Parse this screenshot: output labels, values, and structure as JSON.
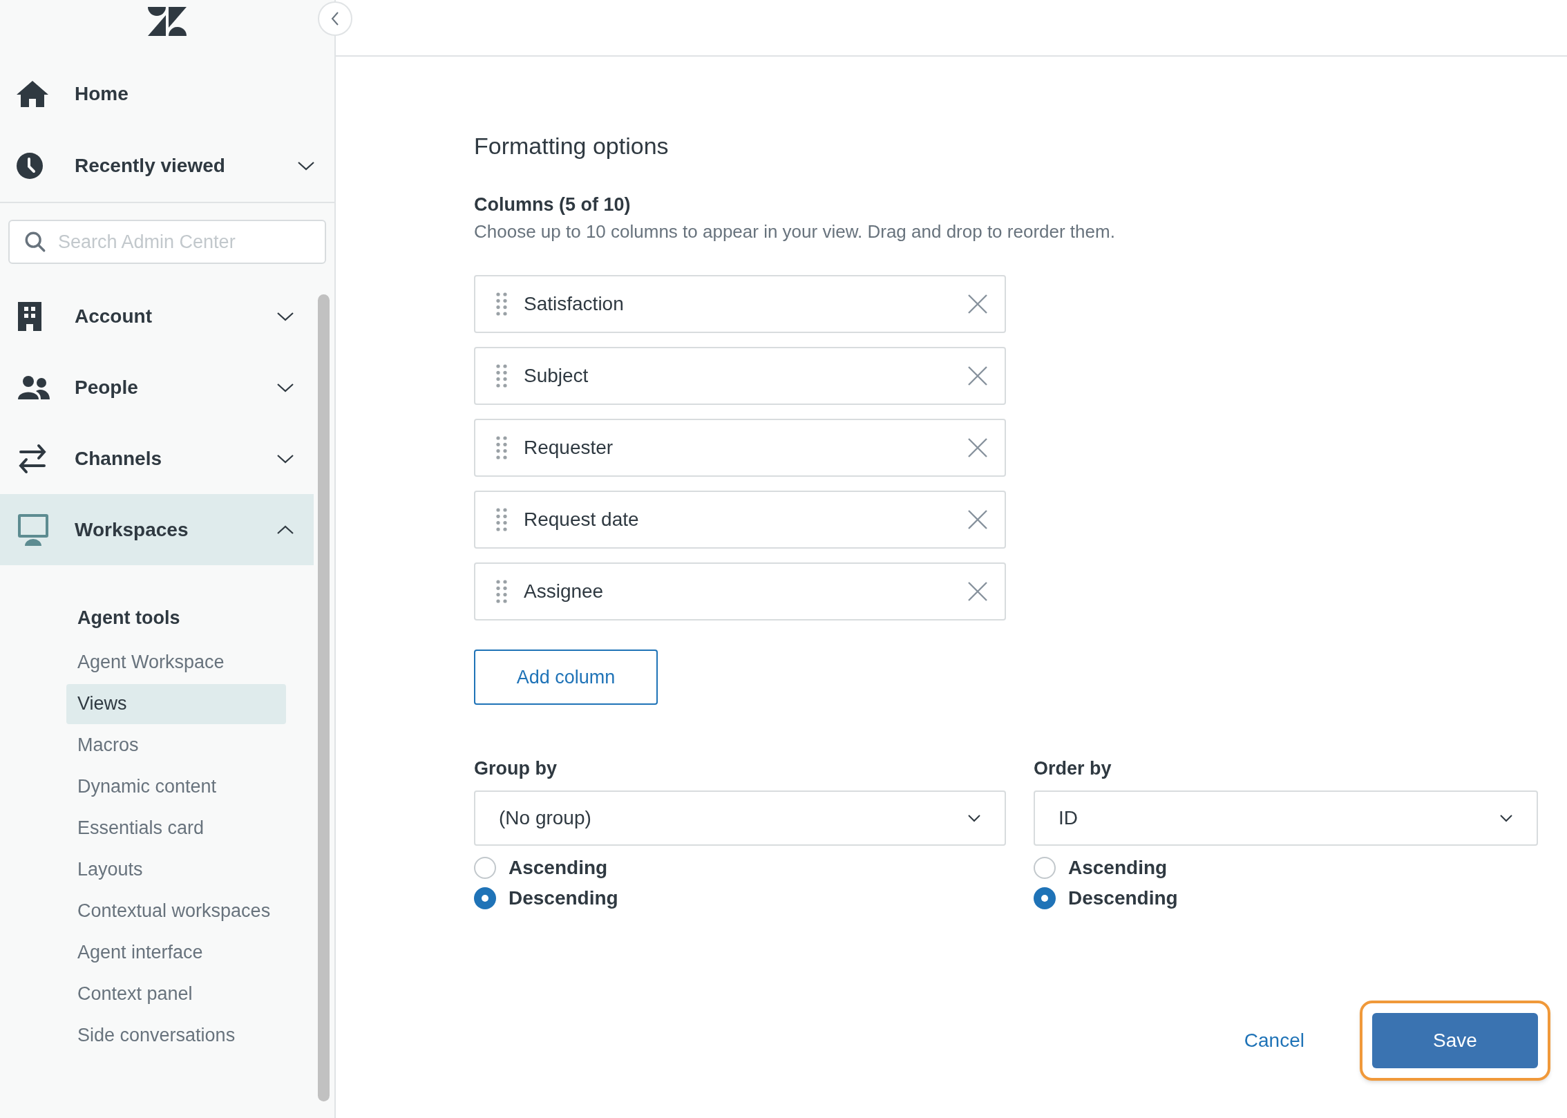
{
  "sidebar": {
    "top_items": [
      {
        "label": "Home",
        "kind": "link"
      },
      {
        "label": "Recently viewed",
        "kind": "menu",
        "expanded": false
      }
    ],
    "search": {
      "placeholder": "Search Admin Center"
    },
    "nav_items": [
      {
        "label": "Account",
        "expanded": false,
        "selected": false
      },
      {
        "label": "People",
        "expanded": false,
        "selected": false
      },
      {
        "label": "Channels",
        "expanded": false,
        "selected": false
      },
      {
        "label": "Workspaces",
        "expanded": true,
        "selected": true,
        "section": {
          "heading": "Agent tools",
          "items": [
            {
              "label": "Agent Workspace",
              "selected": false
            },
            {
              "label": "Views",
              "selected": true
            },
            {
              "label": "Macros",
              "selected": false
            },
            {
              "label": "Dynamic content",
              "selected": false
            },
            {
              "label": "Essentials card",
              "selected": false
            },
            {
              "label": "Layouts",
              "selected": false
            },
            {
              "label": "Contextual workspaces",
              "selected": false
            },
            {
              "label": "Agent interface",
              "selected": false
            },
            {
              "label": "Context panel",
              "selected": false
            },
            {
              "label": "Side conversations",
              "selected": false
            }
          ]
        }
      }
    ]
  },
  "main": {
    "heading": "Formatting options",
    "columns": {
      "title": "Columns (5 of 10)",
      "description": "Choose up to 10 columns to appear in your view. Drag and drop to reorder them.",
      "items": [
        "Satisfaction",
        "Subject",
        "Requester",
        "Request date",
        "Assignee"
      ],
      "add_button": "Add column"
    },
    "sorts": [
      {
        "label": "Group by",
        "value": "(No group)",
        "options": [
          {
            "label": "Ascending",
            "selected": false
          },
          {
            "label": "Descending",
            "selected": true
          }
        ]
      },
      {
        "label": "Order by",
        "value": "ID",
        "options": [
          {
            "label": "Ascending",
            "selected": false
          },
          {
            "label": "Descending",
            "selected": true
          }
        ]
      }
    ],
    "footer": {
      "cancel": "Cancel",
      "save": {
        "label": "Save",
        "focused": true
      }
    }
  }
}
